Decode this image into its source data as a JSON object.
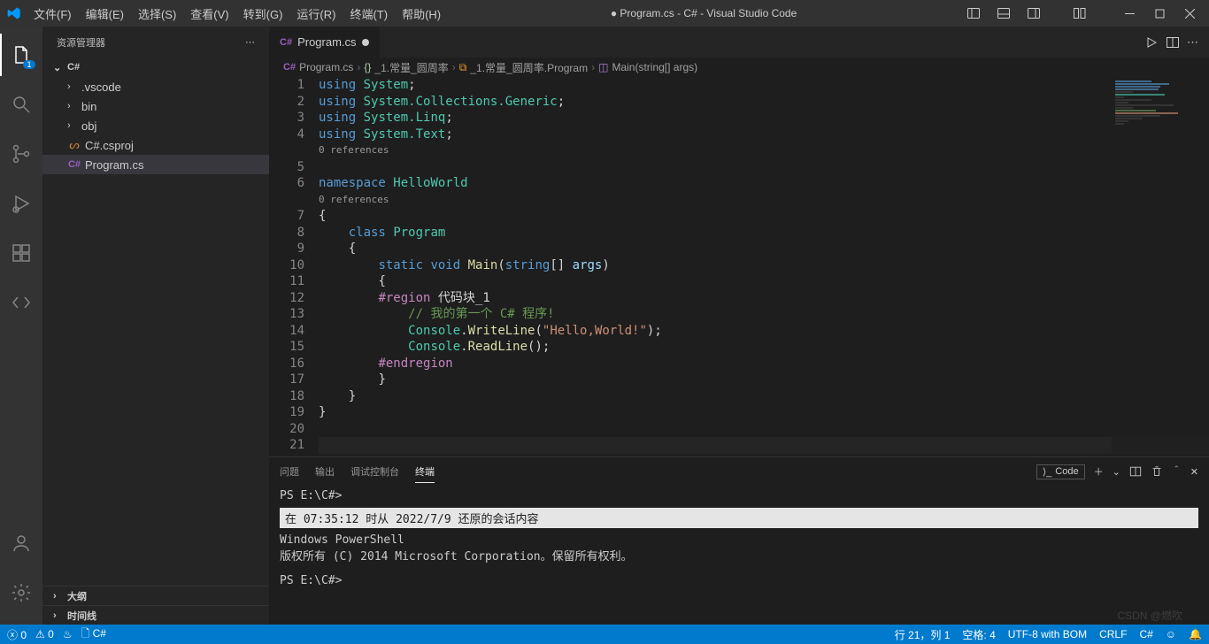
{
  "title": "● Program.cs - C# - Visual Studio Code",
  "menu": [
    "文件(F)",
    "编辑(E)",
    "选择(S)",
    "查看(V)",
    "转到(G)",
    "运行(R)",
    "终端(T)",
    "帮助(H)"
  ],
  "activity_badge": "1",
  "sidebar": {
    "title": "资源管理器",
    "root": "C#",
    "items": [
      {
        "type": "folder",
        "label": ".vscode"
      },
      {
        "type": "folder",
        "label": "bin"
      },
      {
        "type": "folder",
        "label": "obj"
      },
      {
        "type": "csproj",
        "label": "C#.csproj"
      },
      {
        "type": "cs",
        "label": "Program.cs",
        "selected": true
      }
    ],
    "outline": "大纲",
    "timeline": "时间线"
  },
  "tab": {
    "label": "Program.cs"
  },
  "breadcrumb": {
    "file": "Program.cs",
    "ns": "_1.常量_圆周率",
    "class": "_1.常量_圆周率.Program",
    "method": "Main(string[] args)"
  },
  "references_text": "0 references",
  "code": {
    "lines_numbers": [
      "1",
      "2",
      "3",
      "4",
      "",
      "5",
      "6",
      "",
      "7",
      "8",
      "9",
      "10",
      "11",
      "12",
      "13",
      "14",
      "15",
      "16",
      "17",
      "18",
      "19",
      "20",
      "21"
    ]
  },
  "code_text": {
    "using": "using",
    "system": "System",
    "collections": "System.Collections.Generic",
    "linq": "System.Linq",
    "text": "System.Text",
    "namespace": "namespace",
    "helloworld": "HelloWorld",
    "class": "class",
    "program": "Program",
    "static": "static",
    "void": "void",
    "main": "Main",
    "string": "string",
    "args": "args",
    "region": "#region",
    "region_name": "代码块_1",
    "comment": "// 我的第一个 C# 程序!",
    "console": "Console",
    "writeline": "WriteLine",
    "hello_str": "\"Hello,World!\"",
    "readline": "ReadLine",
    "endregion": "#endregion"
  },
  "panel": {
    "tabs": [
      "问题",
      "输出",
      "调试控制台",
      "终端"
    ],
    "active": 3,
    "launch_label": "Code",
    "prompt1": "PS E:\\C#>",
    "session": "在 07:35:12 时从 2022/7/9 还原的会话内容",
    "ps_header": "Windows PowerShell",
    "ps_copy": "版权所有 (C) 2014 Microsoft Corporation。保留所有权利。",
    "prompt2": "PS E:\\C#>"
  },
  "status": {
    "errors": "0",
    "warnings": "0",
    "lang_left": "C#",
    "line_col": "行 21，列 1",
    "spaces": "空格: 4",
    "encoding": "UTF-8 with BOM",
    "eol": "CRLF",
    "lang": "C#"
  },
  "watermark": "CSDN @燃吹"
}
